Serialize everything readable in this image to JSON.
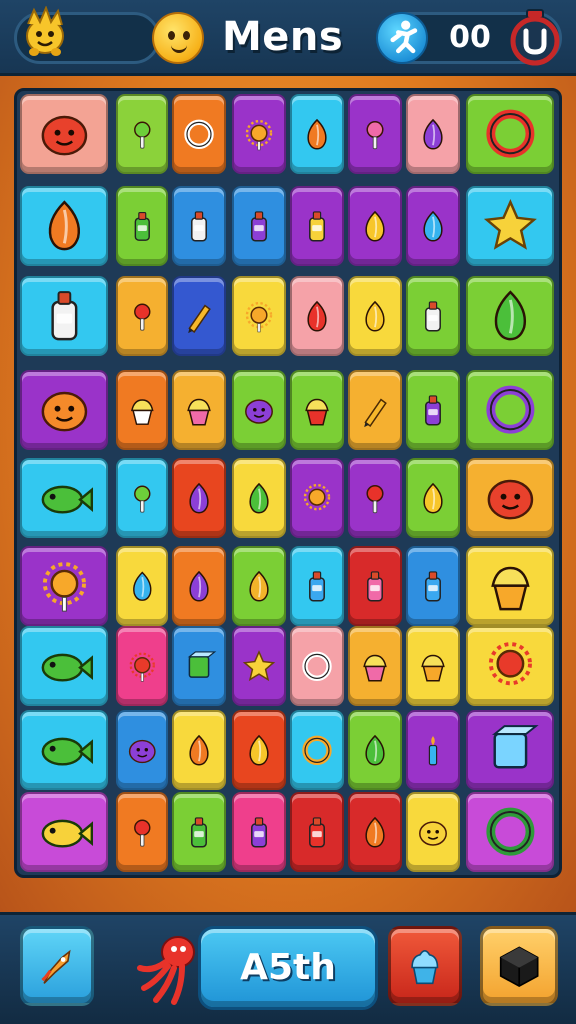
{
  "header": {
    "title": "Mens",
    "score": "00",
    "icons": [
      "mascot-icon",
      "smiley-icon",
      "runner-icon",
      "timer-icon"
    ]
  },
  "footer": {
    "level_label": "A5th",
    "icons": [
      "rocket-icon",
      "octopus-icon",
      "cupcake-icon",
      "cube-icon"
    ]
  },
  "board": {
    "rows": [
      [
        {
          "icon": "red-creature-icon",
          "color": "#f3a394",
          "span": 2
        },
        {
          "icon": "green-sprout-icon",
          "color": "#8bd23a"
        },
        {
          "icon": "white-ring-icon",
          "color": "#f07a22"
        },
        {
          "icon": "sun-lollipop-icon",
          "color": "#9a33c9"
        },
        {
          "icon": "orange-balloon-icon",
          "color": "#33c8f0"
        },
        {
          "icon": "pink-lollipop-icon",
          "color": "#9a33c9"
        },
        {
          "icon": "purple-bean-icon",
          "color": "#f5a2a8"
        },
        {
          "icon": "swirl-badge-icon",
          "color": "#7bcf35",
          "span": 2
        }
      ],
      [
        {
          "icon": "orange-shell-icon",
          "color": "#33c8f0",
          "span": 2
        },
        {
          "icon": "green-bottle-icon",
          "color": "#7bcf35"
        },
        {
          "icon": "milk-carton-icon",
          "color": "#2f8fe0"
        },
        {
          "icon": "purple-potion-icon",
          "color": "#2f8fe0"
        },
        {
          "icon": "juice-box-icon",
          "color": "#9a33c9"
        },
        {
          "icon": "yellow-flame-icon",
          "color": "#9a33c9"
        },
        {
          "icon": "blue-crystal-icon",
          "color": "#9a33c9"
        },
        {
          "icon": "yellow-star-icon",
          "color": "#33c8f0",
          "span": 2
        }
      ],
      [
        {
          "icon": "battery-icon",
          "color": "#33c8f0",
          "span": 2
        },
        {
          "icon": "red-lollipop-icon",
          "color": "#f5b030"
        },
        {
          "icon": "yellow-crayon-icon",
          "color": "#3458d0"
        },
        {
          "icon": "flower-stick-icon",
          "color": "#f8d93c"
        },
        {
          "icon": "red-chili-icon",
          "color": "#f5a2a8"
        },
        {
          "icon": "yellow-cone-icon",
          "color": "#f8d93c"
        },
        {
          "icon": "jar-icon",
          "color": "#7bcf35"
        },
        {
          "icon": "green-leaf-ball-icon",
          "color": "#7bcf35",
          "span": 2
        }
      ],
      [
        {
          "icon": "orange-face-icon",
          "color": "#9a33c9",
          "span": 2
        },
        {
          "icon": "white-mask-icon",
          "color": "#f07a22"
        },
        {
          "icon": "pink-cup-icon",
          "color": "#f5b030"
        },
        {
          "icon": "purple-blob-icon",
          "color": "#7bcf35"
        },
        {
          "icon": "red-dessert-icon",
          "color": "#7bcf35"
        },
        {
          "icon": "orange-pencil-icon",
          "color": "#f5b030"
        },
        {
          "icon": "purple-tube-icon",
          "color": "#7bcf35"
        },
        {
          "icon": "purple-bubble-icon",
          "color": "#7bcf35",
          "span": 2
        }
      ],
      [
        {
          "icon": "green-bird-icon",
          "color": "#33c8f0",
          "span": 2
        },
        {
          "icon": "green-bulb-icon",
          "color": "#33c8f0"
        },
        {
          "icon": "purple-capsule-icon",
          "color": "#e8461f"
        },
        {
          "icon": "green-plant-icon",
          "color": "#f8d93c"
        },
        {
          "icon": "orange-sun-icon",
          "color": "#9a33c9"
        },
        {
          "icon": "red-berry-icon",
          "color": "#9a33c9"
        },
        {
          "icon": "yellow-drop-icon",
          "color": "#7bcf35"
        },
        {
          "icon": "red-blob-icon",
          "color": "#f5b030",
          "span": 2
        }
      ],
      [
        {
          "icon": "orange-sunflower-icon",
          "color": "#9a33c9",
          "span": 2
        },
        {
          "icon": "blue-dolphin-icon",
          "color": "#f8d93c"
        },
        {
          "icon": "purple-pod-icon",
          "color": "#f07a22"
        },
        {
          "icon": "potted-plant-icon",
          "color": "#7bcf35"
        },
        {
          "icon": "blue-bottle-icon",
          "color": "#33c8f0"
        },
        {
          "icon": "pink-jar-icon",
          "color": "#d82a2a"
        },
        {
          "icon": "blue-jar-icon",
          "color": "#2f8fe0"
        },
        {
          "icon": "cake-icon",
          "color": "#f8d93c",
          "span": 2
        }
      ],
      [
        {
          "icon": "green-fish-icon",
          "color": "#33c8f0",
          "span": 2
        },
        {
          "icon": "red-flower-icon",
          "color": "#ef3f8c"
        },
        {
          "icon": "green-robot-icon",
          "color": "#2f8fe0"
        },
        {
          "icon": "yellow-starburst-icon",
          "color": "#9a33c9"
        },
        {
          "icon": "white-donut-icon",
          "color": "#f5a2a8"
        },
        {
          "icon": "pink-dessert-icon",
          "color": "#f5b030"
        },
        {
          "icon": "yellow-cupcake-icon",
          "color": "#f8d93c"
        },
        {
          "icon": "red-wreath-icon",
          "color": "#f8d93c",
          "span": 2
        }
      ],
      [
        {
          "icon": "green-lizard-icon",
          "color": "#33c8f0",
          "span": 2
        },
        {
          "icon": "purple-face-icon",
          "color": "#2f8fe0"
        },
        {
          "icon": "orange-shell-small-icon",
          "color": "#f8d93c"
        },
        {
          "icon": "yellow-tree-icon",
          "color": "#e8461f"
        },
        {
          "icon": "orange-ring-icon",
          "color": "#33c8f0"
        },
        {
          "icon": "green-leaf-icon",
          "color": "#7bcf35"
        },
        {
          "icon": "blue-candle-icon",
          "color": "#9a33c9"
        },
        {
          "icon": "blue-cube-icon",
          "color": "#9a33c9",
          "span": 2
        }
      ],
      [
        {
          "icon": "banana-icon",
          "color": "#c84bd8",
          "span": 2
        },
        {
          "icon": "red-apple-stick-icon",
          "color": "#f07a22"
        },
        {
          "icon": "green-jar-icon",
          "color": "#7bcf35"
        },
        {
          "icon": "purple-lotion-icon",
          "color": "#ef3f8c"
        },
        {
          "icon": "red-canister-icon",
          "color": "#d82a2a"
        },
        {
          "icon": "orange-flame-icon",
          "color": "#d82a2a"
        },
        {
          "icon": "yellow-smile-icon",
          "color": "#f8d93c"
        },
        {
          "icon": "green-swirl-icon",
          "color": "#c84bd8",
          "span": 2
        }
      ]
    ]
  },
  "colors": {
    "topbar": "#1f4466",
    "board_frame": "#1e3a57",
    "board_background": "#e07b1f",
    "level_button": "#2fa9e4"
  }
}
